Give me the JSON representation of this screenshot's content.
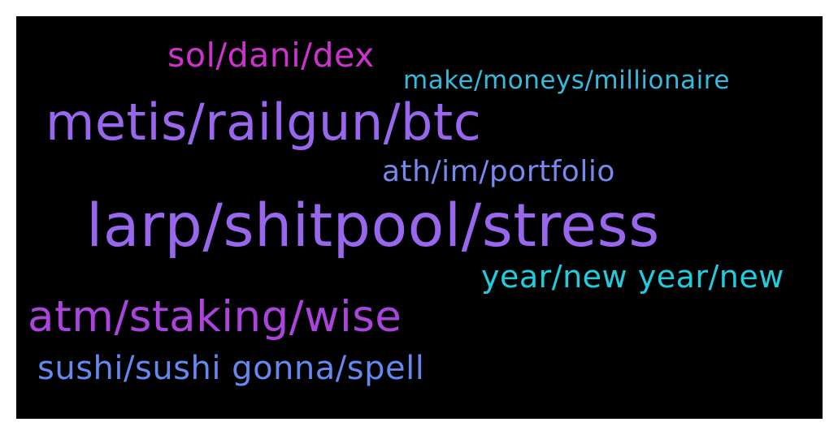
{
  "words": [
    {
      "text": "sol/dani/dex",
      "color": "#cc33cc"
    },
    {
      "text": "make/moneys/millionaire",
      "color": "#33bbdd"
    },
    {
      "text": "metis/railgun/btc",
      "color": "#9966ee"
    },
    {
      "text": "ath/im/portfolio",
      "color": "#7788ee"
    },
    {
      "text": "larp/shitpool/stress",
      "color": "#9966ee"
    },
    {
      "text": "year/new year/new",
      "color": "#22ccdd"
    },
    {
      "text": "atm/staking/wise",
      "color": "#aa44dd"
    },
    {
      "text": "sushi/sushi gonna/spell",
      "color": "#6688ee"
    }
  ]
}
